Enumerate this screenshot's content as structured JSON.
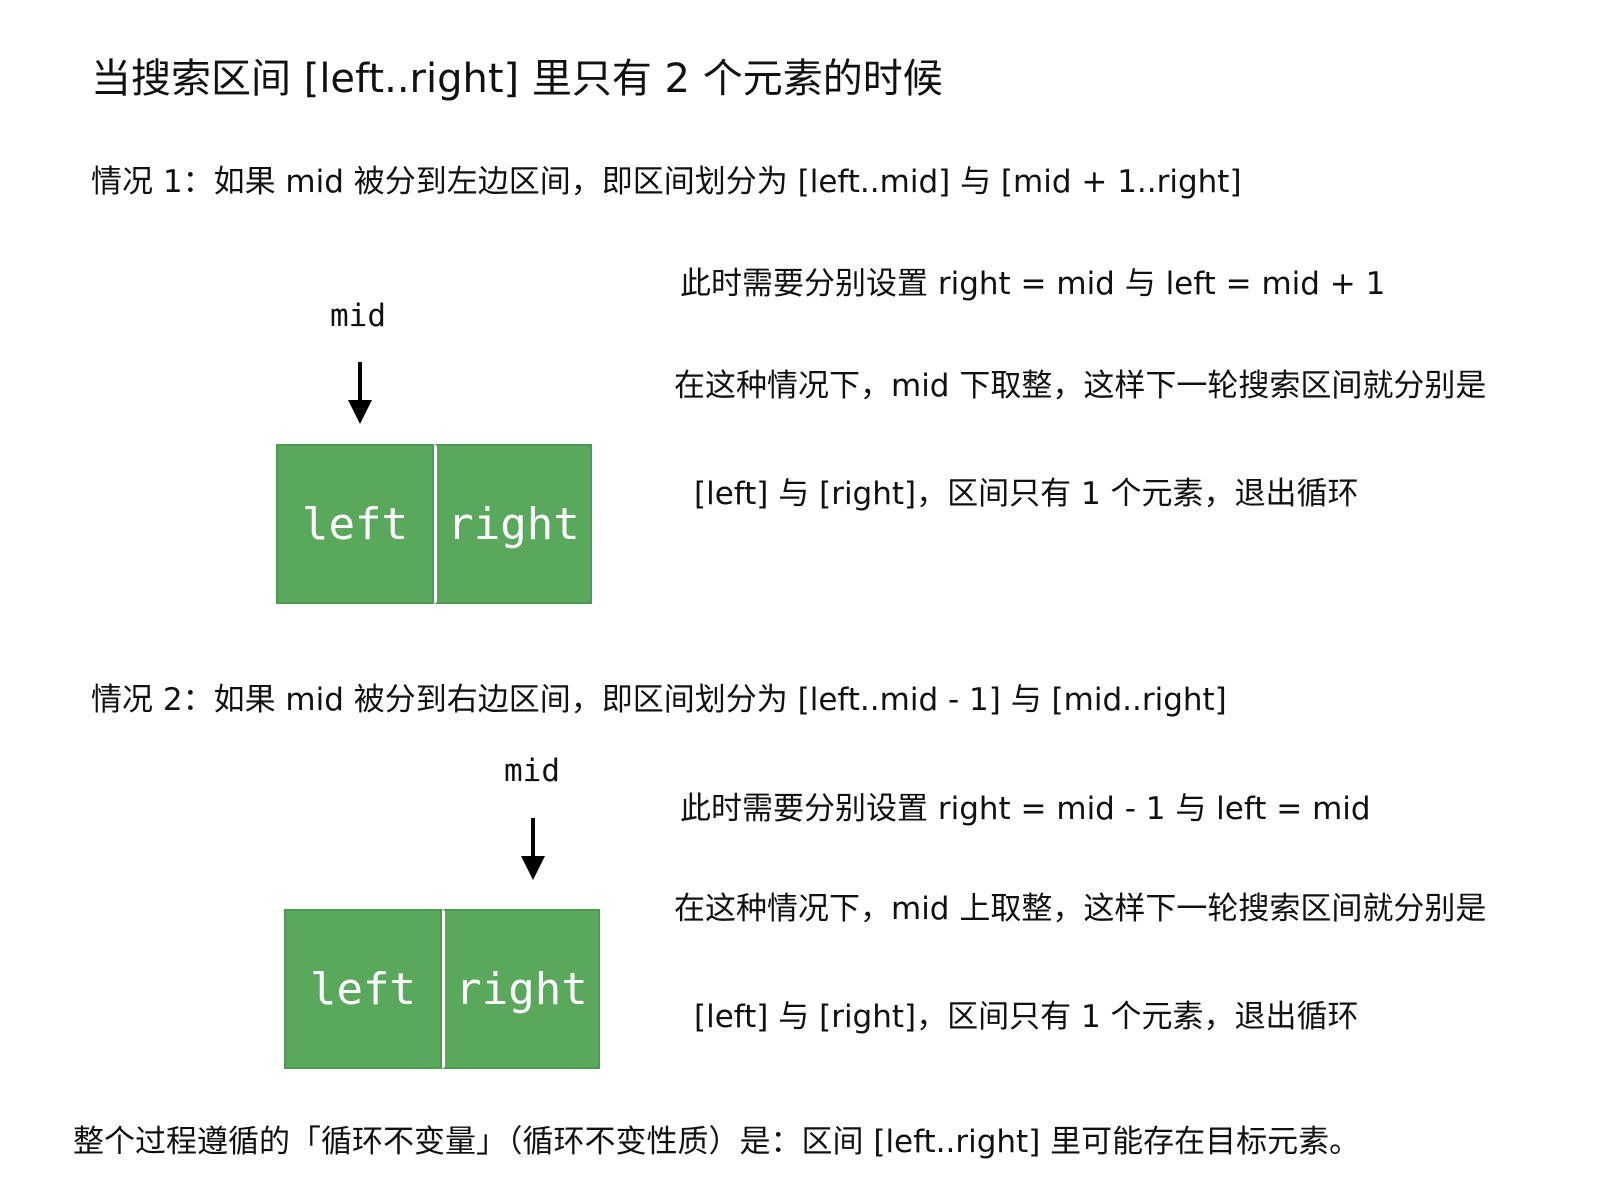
{
  "title": "当搜索区间 [left..right] 里只有 2 个元素的时候",
  "case1": {
    "heading": "情况 1：如果 mid 被分到左边区间，即区间划分为 [left..mid] 与 [mid + 1..right]",
    "mid_label": "mid",
    "cells": [
      "left",
      "right"
    ],
    "notes": [
      "此时需要分别设置 right = mid 与 left = mid + 1",
      "在这种情况下，mid 下取整，这样下一轮搜索区间就分别是",
      "[left] 与 [right]，区间只有 1 个元素，退出循环"
    ]
  },
  "case2": {
    "heading": "情况 2：如果 mid 被分到右边区间，即区间划分为 [left..mid - 1] 与 [mid..right]",
    "mid_label": "mid",
    "cells": [
      "left",
      "right"
    ],
    "notes": [
      "此时需要分别设置 right = mid - 1 与 left = mid",
      "在这种情况下，mid 上取整，这样下一轮搜索区间就分别是",
      "[left] 与 [right]，区间只有 1 个元素，退出循环"
    ]
  },
  "footer": "整个过程遵循的「循环不变量」（循环不变性质）是：区间 [left..right] 里可能存在目标元素。",
  "colors": {
    "cell_fill": "#59a85c",
    "cell_text": "#ffffff",
    "arrow": "#000000"
  }
}
